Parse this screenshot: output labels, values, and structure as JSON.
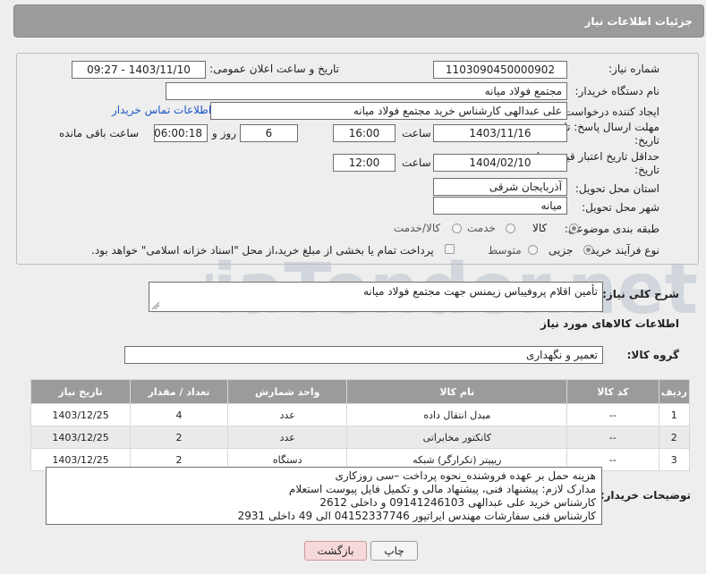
{
  "header": {
    "title": "جزئیات اطلاعات نیاز"
  },
  "watermark": {
    "text": "AriaTender.net"
  },
  "fields": {
    "need_number": {
      "label": "شماره نیاز:",
      "value": "1103090450000902"
    },
    "announce_datetime": {
      "label": "تاریخ و ساعت اعلان عمومی:",
      "value": "1403/11/10 - 09:27"
    },
    "buyer_org": {
      "label": "نام دستگاه خریدار:",
      "value": "مجتمع فولاد میانه"
    },
    "requester": {
      "label": "ایجاد کننده درخواست:",
      "value": "علی عبدالهی کارشناس خرید مجتمع فولاد میانه",
      "contact_link": "اطلاعات تماس خریدار"
    },
    "reply_deadline": {
      "label_line1": "مهلت ارسال پاسخ: تا",
      "label_line2": "تاریخ:",
      "date": "1403/11/16",
      "time_label": "ساعت",
      "time": "16:00",
      "days": "6",
      "days_label": "روز و",
      "remaining_time": "06:00:18",
      "remaining_label": "ساعت باقی مانده"
    },
    "price_validity": {
      "label_line1": "حداقل تاریخ اعتبار قیمت: تا",
      "label_line2": "تاریخ:",
      "date": "1404/02/10",
      "time_label": "ساعت",
      "time": "12:00"
    },
    "delivery_province": {
      "label": "استان محل تحویل:",
      "value": "آذربایجان شرقی"
    },
    "delivery_city": {
      "label": "شهر محل تحویل:",
      "value": "میانه"
    },
    "category": {
      "label": "طبقه بندی موضوعی:",
      "options": [
        "کالا",
        "خدمت",
        "کالا/خدمت"
      ],
      "selected": "کالا"
    },
    "purchase_process": {
      "label": "نوع فرآیند خرید :",
      "options": [
        "جزیی",
        "متوسط"
      ],
      "selected": "جزیی",
      "note": "پرداخت تمام یا بخشی از مبلغ خرید،از محل \"اسناد خزانه اسلامی\" خواهد بود."
    }
  },
  "description": {
    "label": "شرح کلی نیاز:",
    "value": "تأمین اقلام پروفیباس زیمنس جهت مجتمع فولاد میانه"
  },
  "goods_section": {
    "title": "اطلاعات کالاهای مورد نیاز",
    "group_label": "گروه کالا:",
    "group_value": "تعمیر و نگهداری"
  },
  "table": {
    "headers": [
      "ردیف",
      "کد کالا",
      "نام کالا",
      "واحد شمارش",
      "تعداد / مقدار",
      "تاریخ نیاز"
    ],
    "rows": [
      [
        "1",
        "--",
        "مبدل انتقال داده",
        "عدد",
        "4",
        "1403/12/25"
      ],
      [
        "2",
        "--",
        "کانکتور مخابراتی",
        "عدد",
        "2",
        "1403/12/25"
      ],
      [
        "3",
        "--",
        "ریپیتر (تکرارگر) شبکه",
        "دستگاه",
        "2",
        "1403/12/25"
      ]
    ]
  },
  "buyer_notes": {
    "label": "توضیحات خریدار:",
    "lines": [
      "هزینه حمل بر عهده فروشنده_نحوه پرداخت –سی روزکاری",
      "مدارک لازم: پیشنهاد فنی، پیشنهاد مالی و تکمیل فایل پیوست استعلام",
      "کارشناس خرید علی عبدالهی 09141246103 و داخلی 2612",
      "کارشناس فنی سفارشات مهندس ایراتپور 04152337746 الی 49 داخلی 2931"
    ]
  },
  "buttons": {
    "print": "چاپ",
    "back": "بازگشت"
  }
}
